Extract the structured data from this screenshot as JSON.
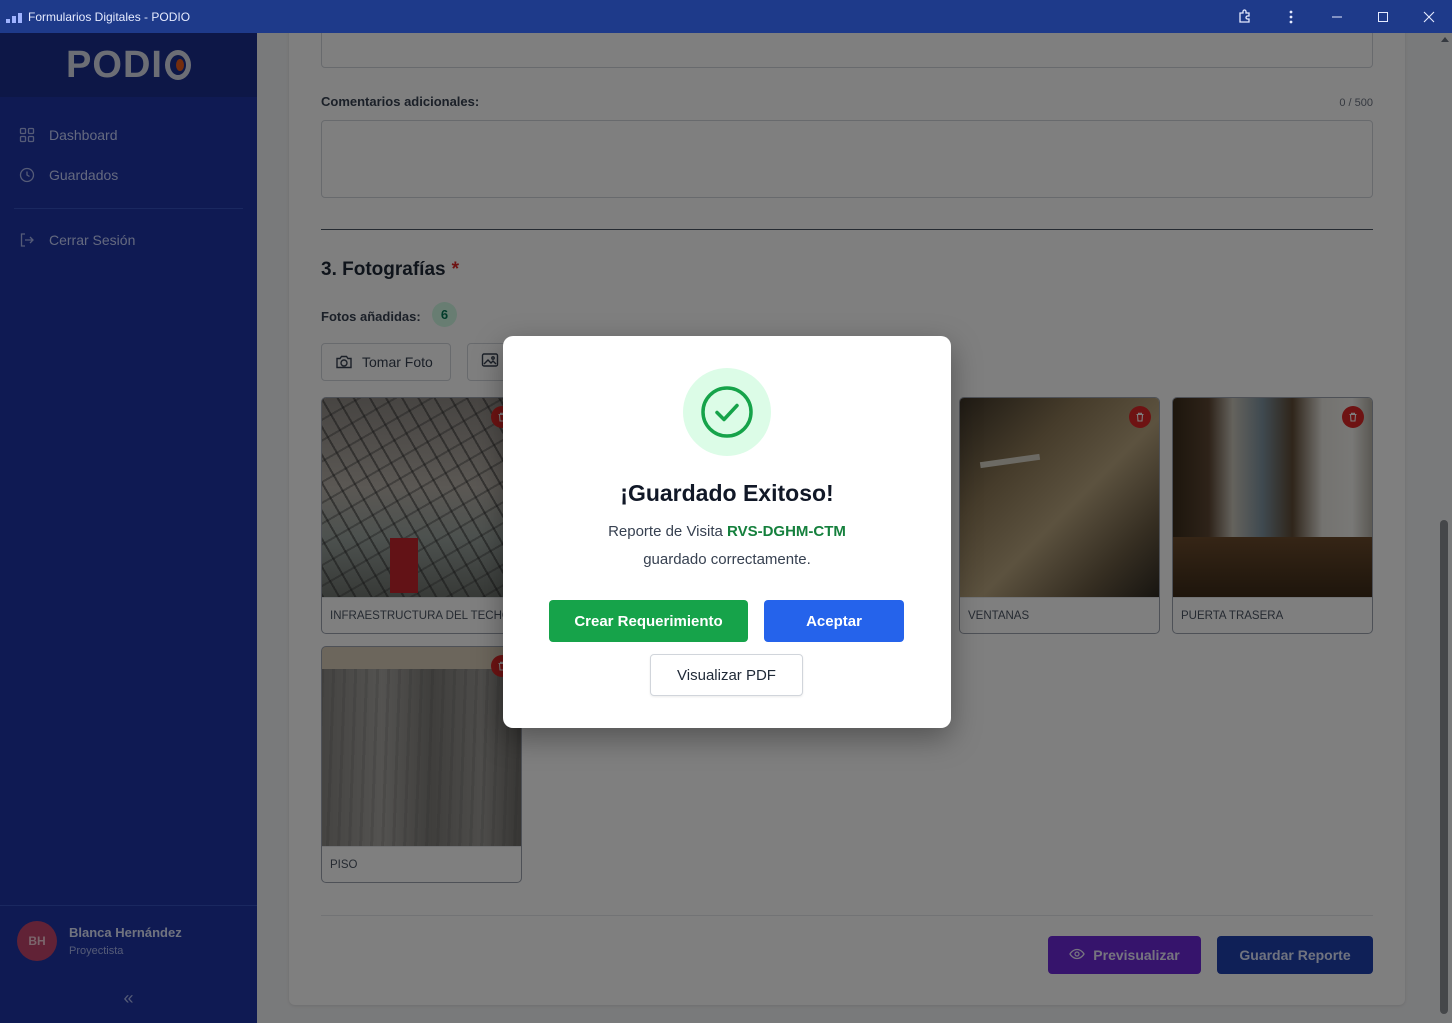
{
  "window": {
    "title": "Formularios Digitales - PODIO",
    "controls": [
      "extensions-icon",
      "more-icon",
      "minimize-icon",
      "maximize-icon",
      "close-icon"
    ]
  },
  "sidebar": {
    "logo": "PODI",
    "items": [
      {
        "label": "Dashboard",
        "icon": "grid-icon"
      },
      {
        "label": "Guardados",
        "icon": "clock-icon"
      },
      {
        "label": "Cerrar Sesión",
        "icon": "logout-icon"
      }
    ],
    "user": {
      "initials": "BH",
      "name": "Blanca Hernández",
      "role": "Proyectista"
    },
    "collapse": "«"
  },
  "form": {
    "comments_label": "Comentarios adicionales:",
    "comments_counter": "0 / 500",
    "comments_value": "",
    "section_title": "3. Fotografías",
    "required_mark": "*",
    "photos_label": "Fotos añadidas:",
    "photos_count": "6",
    "take_photo_label": "Tomar Foto",
    "photos": [
      {
        "caption": "INFRAESTRUCTURA DEL TECHO"
      },
      {
        "caption": "VENTANAS"
      },
      {
        "caption": "PUERTA TRASERA"
      },
      {
        "caption": "PISO"
      }
    ],
    "preview_label": "Previsualizar",
    "save_label": "Guardar Reporte"
  },
  "modal": {
    "title": "¡Guardado Exitoso!",
    "message_prefix": "Reporte de Visita ",
    "report_code": "RVS-DGHM-CTM",
    "message_suffix": "guardado correctamente.",
    "create_label": "Crear Requerimiento",
    "accept_label": "Aceptar",
    "pdf_label": "Visualizar PDF"
  },
  "colors": {
    "sidebar": "#1e35a6",
    "titlebar": "#1e3a8a",
    "success": "#16a34a",
    "primary": "#2563eb",
    "preview": "#6d28d9",
    "danger": "#dc2626"
  }
}
